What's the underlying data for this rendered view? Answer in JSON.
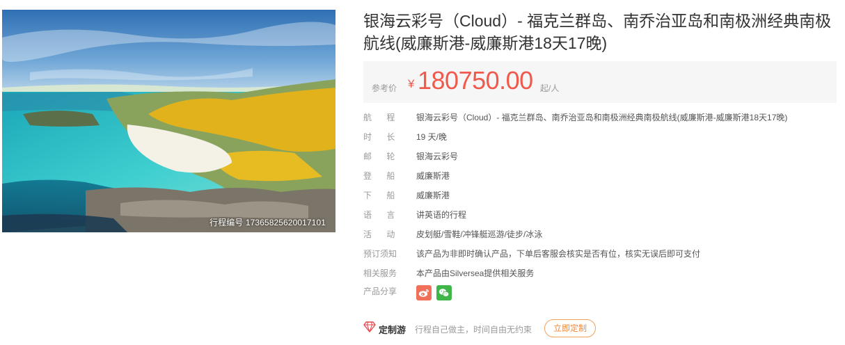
{
  "hero": {
    "route_code": "行程编号 17365825620017101"
  },
  "product": {
    "title": "银海云彩号（Cloud）- 福克兰群岛、南乔治亚岛和南极洲经典南极航线(威廉斯港-威廉斯港18天17晚)"
  },
  "price": {
    "ref_label": "参考价",
    "currency": "¥",
    "amount": "180750.00",
    "unit": "起/人",
    "color": "#ef5a4d"
  },
  "details": [
    {
      "label": "航 程",
      "value": "银海云彩号（Cloud）- 福克兰群岛、南乔治亚岛和南极洲经典南极航线(威廉斯港-威廉斯港18天17晚)"
    },
    {
      "label": "时 长",
      "value": "19 天/晚"
    },
    {
      "label": "邮 轮",
      "value": "银海云彩号"
    },
    {
      "label": "登 船",
      "value": "威廉斯港"
    },
    {
      "label": "下 船",
      "value": "威廉斯港"
    },
    {
      "label": "语 言",
      "value": "讲英语的行程"
    },
    {
      "label": "活 动",
      "value": "皮划艇/雪鞋/冲锋艇巡游/徒步/冰泳"
    },
    {
      "label": "预订须知",
      "value": "该产品为非即时确认产品，下单后客服会核实是否有位，核实无误后即可支付"
    },
    {
      "label": "相关服务",
      "value": "本产品由Silversea提供相关服务"
    }
  ],
  "share": {
    "label": "产品分享",
    "icons": [
      "weibo-icon",
      "wechat-icon"
    ]
  },
  "custom": {
    "title": "定制游",
    "description": "行程自己做主，时间自由无约束",
    "button": "立即定制",
    "accent": "#f08a3c"
  }
}
